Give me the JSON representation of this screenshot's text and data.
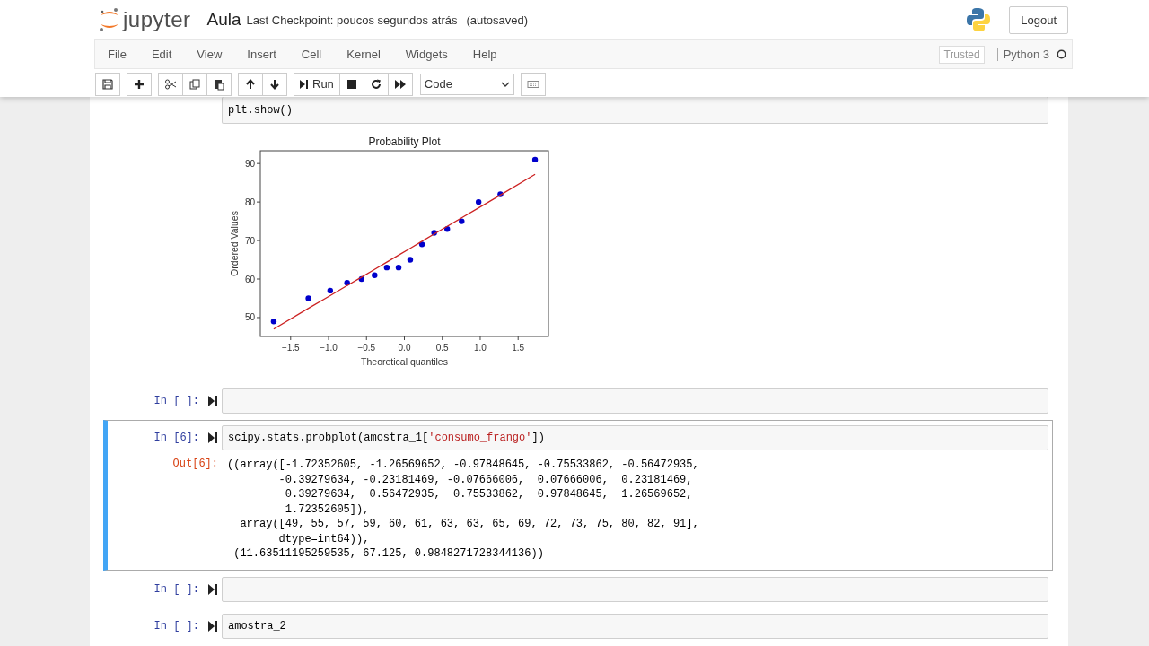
{
  "header": {
    "logo_text": "jupyter",
    "notebook_name": "Aula",
    "checkpoint": "Last Checkpoint: poucos segundos atrás",
    "autosave": "(autosaved)",
    "logout": "Logout"
  },
  "menu": [
    "File",
    "Edit",
    "View",
    "Insert",
    "Cell",
    "Kernel",
    "Widgets",
    "Help"
  ],
  "toolbar": {
    "run_label": "Run",
    "cell_type": "Code"
  },
  "status": {
    "trusted": "Trusted",
    "kernel": "Python 3",
    "kernel_busy": false
  },
  "cells": [
    {
      "selected": false,
      "code": [
        "plt.show()"
      ],
      "output": {
        "kind": "chart",
        "chart_data": {
          "type": "scatter",
          "title": "Probability Plot",
          "xlabel": "Theoretical quantiles",
          "ylabel": "Ordered Values",
          "x": [
            -1.72352605,
            -1.26569652,
            -0.97848645,
            -0.75533862,
            -0.56472935,
            -0.39279634,
            -0.23181469,
            -0.07666006,
            0.07666006,
            0.23181469,
            0.39279634,
            0.56472935,
            0.75533862,
            0.97848645,
            1.26569652,
            1.72352605
          ],
          "series": [
            {
              "type": "scatter",
              "color": "#0000cc",
              "values": [
                49,
                55,
                57,
                59,
                60,
                61,
                63,
                63,
                65,
                69,
                72,
                73,
                75,
                80,
                82,
                91
              ]
            },
            {
              "type": "line",
              "color": "#cc2222",
              "values": [
                47,
                52.4,
                55.7,
                58.3,
                60.5,
                62.5,
                64.4,
                66.2,
                68,
                69.8,
                71.7,
                73.7,
                75.9,
                78.5,
                81.8,
                87.2
              ]
            }
          ],
          "xlim": [
            -1.9,
            1.9
          ],
          "ylim": [
            45.1,
            93.3
          ],
          "xticks": [
            {
              "value": -1.5,
              "label": "−1.5"
            },
            {
              "value": -1,
              "label": "−1.0"
            },
            {
              "value": -0.5,
              "label": "−0.5"
            },
            {
              "value": 0,
              "label": "0.0"
            },
            {
              "value": 0.5,
              "label": "0.5"
            },
            {
              "value": 1,
              "label": "1.0"
            },
            {
              "value": 1.5,
              "label": "1.5"
            }
          ],
          "yticks": [
            50,
            60,
            70,
            80,
            90
          ]
        }
      }
    },
    {
      "prompt": "In [ ]:",
      "selected": false
    },
    {
      "prompt": "In [6]:",
      "selected": true,
      "code": [
        "scipy.stats.probplot(amostra_1['consumo_frango'])"
      ],
      "output": {
        "kind": "text",
        "prompt": "Out[6]:",
        "lines": [
          "((array([-1.72352605, -1.26569652, -0.97848645, -0.75533862, -0.56472935,",
          "        -0.39279634, -0.23181469, -0.07666006,  0.07666006,  0.23181469,",
          "         0.39279634,  0.56472935,  0.75533862,  0.97848645,  1.26569652,",
          "         1.72352605]),",
          "  array([49, 55, 57, 59, 60, 61, 63, 63, 65, 69, 72, 73, 75, 80, 82, 91],",
          "        dtype=int64)),",
          " (11.63511195259535, 67.125, 0.9848271728344136))"
        ]
      }
    },
    {
      "prompt": "In [ ]:",
      "selected": false
    },
    {
      "prompt": "In [ ]:",
      "selected": false,
      "code": [
        "amostra_2"
      ]
    }
  ]
}
